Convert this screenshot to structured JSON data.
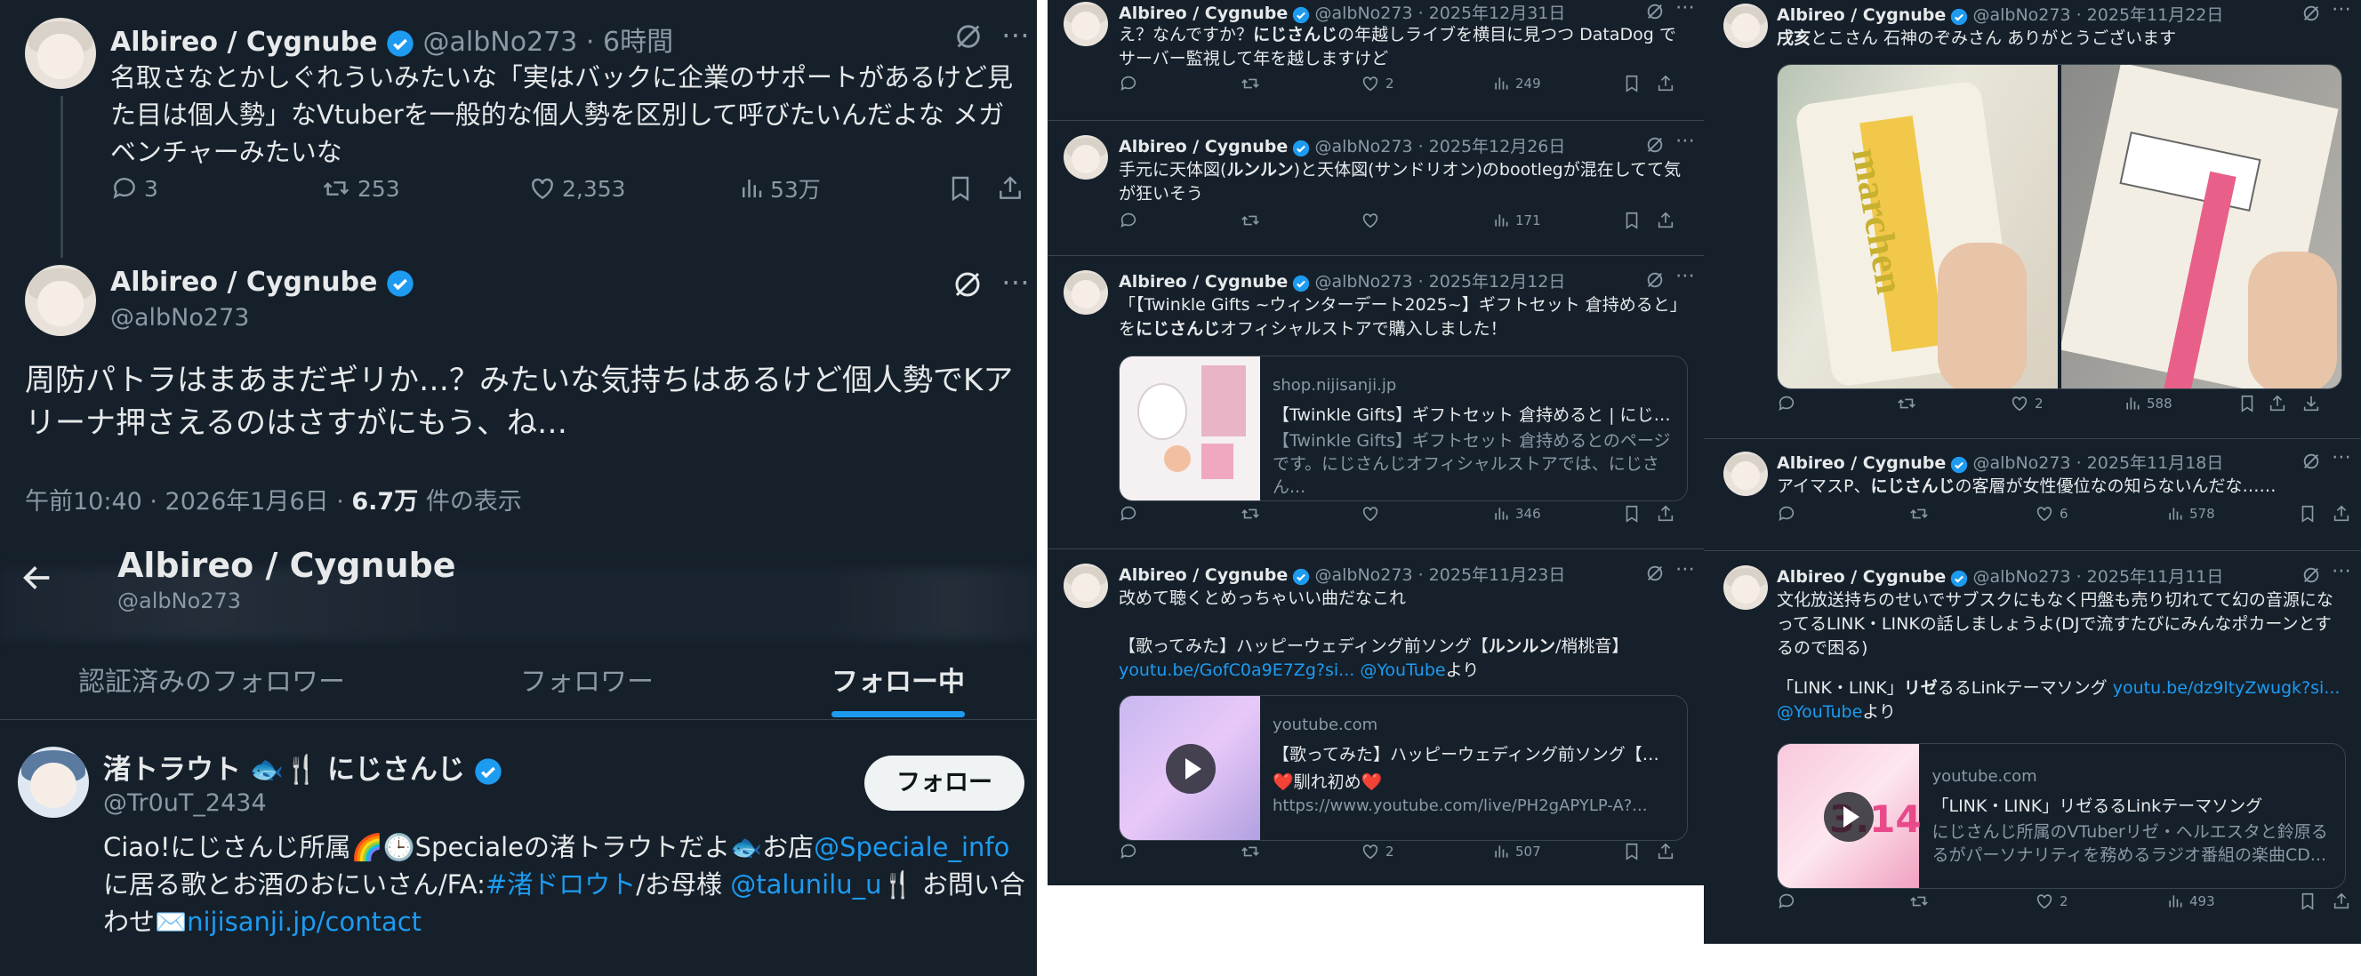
{
  "panel_a": {
    "tweet1": {
      "name": "Albireo / Cygnube",
      "handle": "@albNo273",
      "time": "· 6時間",
      "text": "名取さなとかしぐれういみたいな「実はバックに企業のサポートがあるけど見た目は個人勢」なVtuberを一般的な個人勢を区別して呼びたいんだよな メガベンチャーみたいな",
      "replies": "3",
      "retweets": "253",
      "likes": "2,353",
      "views": "53万"
    },
    "tweet2": {
      "name": "Albireo / Cygnube",
      "handle": "@albNo273",
      "text": "周防パトラはまあまだギリか…？みたいな気持ちはあるけど個人勢でKアリーナ押さえるのはさすがにもう、ね…",
      "time": "午前10:40 · 2026年1月6日 ·",
      "views_count": "6.7万",
      "views_label": "件の表示"
    },
    "profile": {
      "back_icon": "back-arrow-icon",
      "name": "Albireo / Cygnube",
      "handle": "@albNo273",
      "tabs": [
        "認証済みのフォロワー",
        "フォロワー",
        "フォロー中"
      ],
      "active_tab": 2
    },
    "follow_item": {
      "name_pre": "渚トラウト",
      "name_post": "にじさんじ",
      "handle": "@Tr0uT_2434",
      "follow_label": "フォロー",
      "bio_1": "Ciao!にじさんじ所属",
      "bio_2": "Specialeの渚トラウトだよ",
      "bio_3": "お店",
      "bio_link1": "@Speciale_info",
      "bio_4": "に居る歌とお酒のおにいさん/FA:",
      "bio_link2": "#渚ドロウト",
      "bio_5": "/お母様 ",
      "bio_link3": "@talunilu_u",
      "bio_6": " お問い合わせ",
      "bio_link4": "nijisanji.jp/contact"
    }
  },
  "panel_b": {
    "tweets": [
      {
        "name": "Albireo / Cygnube",
        "meta": "@albNo273 · 2025年12月31日",
        "t1": "え？なんですか？",
        "t1b": "にじさんじ",
        "t2": "の年越しライブを横目に見つつ DataDog でサーバー監視して年を越しますけど",
        "likes": "2",
        "views": "249"
      },
      {
        "name": "Albireo / Cygnube",
        "meta": "@albNo273 · 2025年12月26日",
        "t1": "手元に天体図(",
        "t1b": "ルンルン",
        "t2": ")と天体図(サンドリオン)のbootlegが混在してて気が狂いそう",
        "likes": "",
        "views": "171"
      },
      {
        "name": "Albireo / Cygnube",
        "meta": "@albNo273 · 2025年12月12日",
        "t1": "「【Twinkle Gifts ~ウィンターデート2025~】ギフトセット 倉持めると」を",
        "t1b": "にじさんじ",
        "t2": "オフィシャルストアで購入しました！",
        "card_domain": "shop.nijisanji.jp",
        "card_title": "【Twinkle Gifts】ギフトセット 倉持めると | にじさ...",
        "card_desc": "【Twinkle Gifts】ギフトセット 倉持めるとのページです。にじさんじオフィシャルストアでは、にじさん...",
        "likes": "",
        "views": "346"
      },
      {
        "name": "Albireo / Cygnube",
        "meta": "@albNo273 · 2025年11月23日",
        "t1": "改めて聴くとめっちゃいい曲だなこれ",
        "t2a": "【歌ってみた】ハッピーウェディング前ソング【",
        "t2b": "ルンルン",
        "t2c": "/梢桃音】",
        "link": "youtu.be/GofC0a9E7Zg?si...",
        "at": "@YouTube",
        "yori": "より",
        "card_domain": "youtube.com",
        "card_title": "【歌ってみた】ハッピーウェディング前ソング【ル...",
        "card_desc": "❤️馴れ初め❤️",
        "card_url": "https://www.youtube.com/live/PH2gAPYLP-A?...",
        "likes": "2",
        "views": "507"
      }
    ]
  },
  "panel_c": {
    "tweets": [
      {
        "name": "Albireo / Cygnube",
        "meta": "@albNo273 · 2025年11月22日",
        "t1b": "戌亥",
        "t2": "とこさん 石神のぞみさん ありがとうございます",
        "photo_text": "marchen",
        "likes": "2",
        "views": "588"
      },
      {
        "name": "Albireo / Cygnube",
        "meta": "@albNo273 · 2025年11月18日",
        "t1": "アイマスP、",
        "t1b": "にじさんじ",
        "t2": "の客層が女性優位なの知らないんだな……",
        "likes": "6",
        "views": "578"
      },
      {
        "name": "Albireo / Cygnube",
        "meta": "@albNo273 · 2025年11月11日",
        "t1": "文化放送持ちのせいでサブスクにもなく円盤も売り切れてて幻の音源になってるLINK・LINKの話しましょうよ(DJで流すたびにみんなポカーンとするので困る)",
        "t2a": "「LINK・LINK」",
        "t2b": "リゼ",
        "t2c": "るるLinkテーマソング ",
        "link": "youtu.be/dz9ltyZwugk?si...",
        "at": "@YouTube",
        "yori": "より",
        "card_domain": "youtube.com",
        "card_title": "「LINK・LINK」リゼるるLinkテーマソング",
        "card_desc": "にじさんじ所属のVTuberリゼ・ヘルエスタと鈴原るるがパーソナリティを務めるラジオ番組の楽曲CD...",
        "thumb_text": "3.14",
        "likes": "2",
        "views": "493"
      }
    ]
  }
}
